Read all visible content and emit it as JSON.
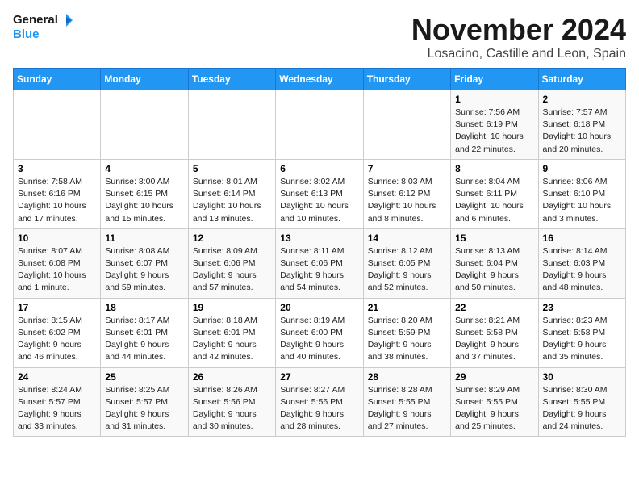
{
  "logo": {
    "line1": "General",
    "line2": "Blue"
  },
  "title": "November 2024",
  "location": "Losacino, Castille and Leon, Spain",
  "days_of_week": [
    "Sunday",
    "Monday",
    "Tuesday",
    "Wednesday",
    "Thursday",
    "Friday",
    "Saturday"
  ],
  "weeks": [
    [
      {
        "day": "",
        "info": ""
      },
      {
        "day": "",
        "info": ""
      },
      {
        "day": "",
        "info": ""
      },
      {
        "day": "",
        "info": ""
      },
      {
        "day": "",
        "info": ""
      },
      {
        "day": "1",
        "info": "Sunrise: 7:56 AM\nSunset: 6:19 PM\nDaylight: 10 hours\nand 22 minutes."
      },
      {
        "day": "2",
        "info": "Sunrise: 7:57 AM\nSunset: 6:18 PM\nDaylight: 10 hours\nand 20 minutes."
      }
    ],
    [
      {
        "day": "3",
        "info": "Sunrise: 7:58 AM\nSunset: 6:16 PM\nDaylight: 10 hours\nand 17 minutes."
      },
      {
        "day": "4",
        "info": "Sunrise: 8:00 AM\nSunset: 6:15 PM\nDaylight: 10 hours\nand 15 minutes."
      },
      {
        "day": "5",
        "info": "Sunrise: 8:01 AM\nSunset: 6:14 PM\nDaylight: 10 hours\nand 13 minutes."
      },
      {
        "day": "6",
        "info": "Sunrise: 8:02 AM\nSunset: 6:13 PM\nDaylight: 10 hours\nand 10 minutes."
      },
      {
        "day": "7",
        "info": "Sunrise: 8:03 AM\nSunset: 6:12 PM\nDaylight: 10 hours\nand 8 minutes."
      },
      {
        "day": "8",
        "info": "Sunrise: 8:04 AM\nSunset: 6:11 PM\nDaylight: 10 hours\nand 6 minutes."
      },
      {
        "day": "9",
        "info": "Sunrise: 8:06 AM\nSunset: 6:10 PM\nDaylight: 10 hours\nand 3 minutes."
      }
    ],
    [
      {
        "day": "10",
        "info": "Sunrise: 8:07 AM\nSunset: 6:08 PM\nDaylight: 10 hours\nand 1 minute."
      },
      {
        "day": "11",
        "info": "Sunrise: 8:08 AM\nSunset: 6:07 PM\nDaylight: 9 hours\nand 59 minutes."
      },
      {
        "day": "12",
        "info": "Sunrise: 8:09 AM\nSunset: 6:06 PM\nDaylight: 9 hours\nand 57 minutes."
      },
      {
        "day": "13",
        "info": "Sunrise: 8:11 AM\nSunset: 6:06 PM\nDaylight: 9 hours\nand 54 minutes."
      },
      {
        "day": "14",
        "info": "Sunrise: 8:12 AM\nSunset: 6:05 PM\nDaylight: 9 hours\nand 52 minutes."
      },
      {
        "day": "15",
        "info": "Sunrise: 8:13 AM\nSunset: 6:04 PM\nDaylight: 9 hours\nand 50 minutes."
      },
      {
        "day": "16",
        "info": "Sunrise: 8:14 AM\nSunset: 6:03 PM\nDaylight: 9 hours\nand 48 minutes."
      }
    ],
    [
      {
        "day": "17",
        "info": "Sunrise: 8:15 AM\nSunset: 6:02 PM\nDaylight: 9 hours\nand 46 minutes."
      },
      {
        "day": "18",
        "info": "Sunrise: 8:17 AM\nSunset: 6:01 PM\nDaylight: 9 hours\nand 44 minutes."
      },
      {
        "day": "19",
        "info": "Sunrise: 8:18 AM\nSunset: 6:01 PM\nDaylight: 9 hours\nand 42 minutes."
      },
      {
        "day": "20",
        "info": "Sunrise: 8:19 AM\nSunset: 6:00 PM\nDaylight: 9 hours\nand 40 minutes."
      },
      {
        "day": "21",
        "info": "Sunrise: 8:20 AM\nSunset: 5:59 PM\nDaylight: 9 hours\nand 38 minutes."
      },
      {
        "day": "22",
        "info": "Sunrise: 8:21 AM\nSunset: 5:58 PM\nDaylight: 9 hours\nand 37 minutes."
      },
      {
        "day": "23",
        "info": "Sunrise: 8:23 AM\nSunset: 5:58 PM\nDaylight: 9 hours\nand 35 minutes."
      }
    ],
    [
      {
        "day": "24",
        "info": "Sunrise: 8:24 AM\nSunset: 5:57 PM\nDaylight: 9 hours\nand 33 minutes."
      },
      {
        "day": "25",
        "info": "Sunrise: 8:25 AM\nSunset: 5:57 PM\nDaylight: 9 hours\nand 31 minutes."
      },
      {
        "day": "26",
        "info": "Sunrise: 8:26 AM\nSunset: 5:56 PM\nDaylight: 9 hours\nand 30 minutes."
      },
      {
        "day": "27",
        "info": "Sunrise: 8:27 AM\nSunset: 5:56 PM\nDaylight: 9 hours\nand 28 minutes."
      },
      {
        "day": "28",
        "info": "Sunrise: 8:28 AM\nSunset: 5:55 PM\nDaylight: 9 hours\nand 27 minutes."
      },
      {
        "day": "29",
        "info": "Sunrise: 8:29 AM\nSunset: 5:55 PM\nDaylight: 9 hours\nand 25 minutes."
      },
      {
        "day": "30",
        "info": "Sunrise: 8:30 AM\nSunset: 5:55 PM\nDaylight: 9 hours\nand 24 minutes."
      }
    ]
  ]
}
